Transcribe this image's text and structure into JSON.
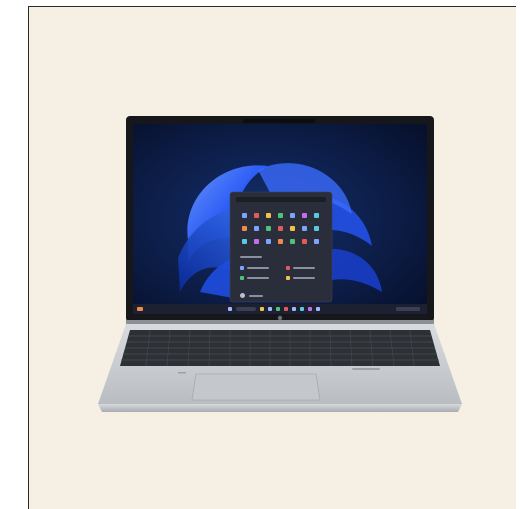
{
  "image": {
    "subject": "laptop-product-photo",
    "colors": {
      "background": "#f5efe4",
      "frame_border": "#2b2b2b",
      "chassis_silver": "#cfd2d6",
      "keyboard_dark": "#2d3035",
      "screen_bezel": "#15171b",
      "wallpaper_base": "#0b1a4a",
      "bloom_blue": "#2a5cff",
      "start_menu": "#2a2d3a"
    },
    "icons": [
      "windows-bloom-wallpaper",
      "start-menu",
      "taskbar",
      "hp-logo"
    ]
  }
}
